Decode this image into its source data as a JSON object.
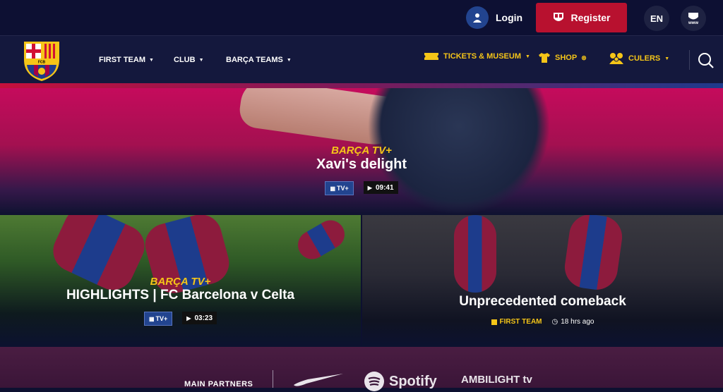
{
  "topbar": {
    "login_label": "Login",
    "register_label": "Register",
    "language": "EN",
    "www_label": "www"
  },
  "nav": {
    "left_items": [
      {
        "label": "FIRST TEAM"
      },
      {
        "label": "CLUB"
      },
      {
        "label": "BARÇA TEAMS"
      }
    ],
    "right_items": [
      {
        "label": "TICKETS & MUSEUM",
        "icon": "ticket-icon"
      },
      {
        "label": "SHOP",
        "icon": "shirt-icon"
      },
      {
        "label": "CULERS",
        "icon": "culers-icon"
      }
    ],
    "crest_text": "FCB"
  },
  "hero": {
    "channel": "BARÇA TV+",
    "title": "Xavi's delight",
    "badge": "TV+",
    "duration": "09:41"
  },
  "cards": [
    {
      "channel": "BARÇA TV+",
      "title": "HIGHLIGHTS | FC Barcelona v Celta",
      "badge": "TV+",
      "duration": "03:23"
    },
    {
      "title": "Unprecedented comeback",
      "tag": "FIRST TEAM",
      "time": "18 hrs ago"
    }
  ],
  "partners": {
    "label": "MAIN PARTNERS",
    "logos": [
      "Spotify",
      "AMBILIGHT tv"
    ]
  },
  "colors": {
    "navy": "#0d1033",
    "accent_red": "#b8112f",
    "gold": "#f5c518",
    "blue": "#22448f"
  }
}
